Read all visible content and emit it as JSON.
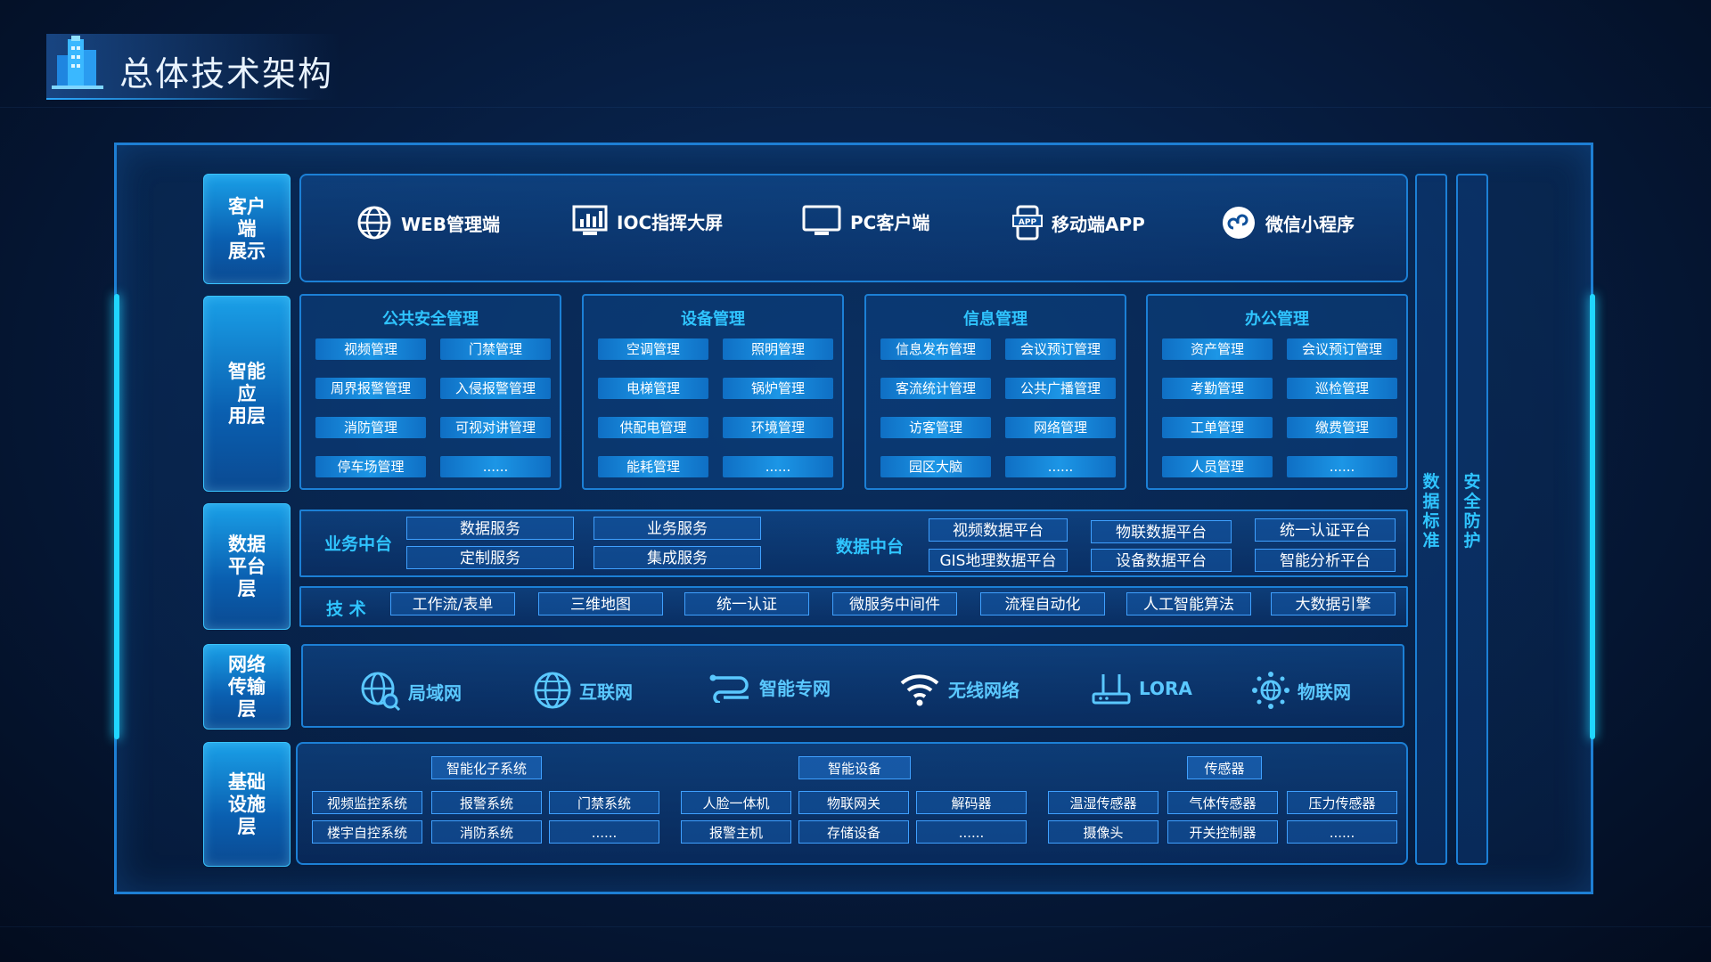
{
  "page_title": "总体技术架构",
  "layers": {
    "client": "客户端\n展示",
    "app": "智能应\n用层",
    "data": "数据\n平台层",
    "network": "网络\n传输层",
    "infra": "基础\n设施层"
  },
  "clients": [
    {
      "label": "WEB管理端",
      "icon": "globe-icon"
    },
    {
      "label": "IOC指挥大屏",
      "icon": "bar-chart-screen-icon"
    },
    {
      "label": "PC客户端",
      "icon": "monitor-icon"
    },
    {
      "label": "移动端APP",
      "icon": "mobile-app-icon"
    },
    {
      "label": "微信小程序",
      "icon": "mini-program-icon"
    }
  ],
  "app_groups": [
    {
      "title": "公共安全管理",
      "items": [
        "视频管理",
        "门禁管理",
        "周界报警管理",
        "入侵报警管理",
        "消防管理",
        "可视对讲管理",
        "停车场管理",
        "......"
      ]
    },
    {
      "title": "设备管理",
      "items": [
        "空调管理",
        "照明管理",
        "电梯管理",
        "锅炉管理",
        "供配电管理",
        "环境管理",
        "能耗管理",
        "......"
      ]
    },
    {
      "title": "信息管理",
      "items": [
        "信息发布管理",
        "会议预订管理",
        "客流统计管理",
        "公共广播管理",
        "访客管理",
        "网络管理",
        "园区大脑",
        "......"
      ]
    },
    {
      "title": "办公管理",
      "items": [
        "资产管理",
        "会议预订管理",
        "考勤管理",
        "巡检管理",
        "工单管理",
        "缴费管理",
        "人员管理",
        "......"
      ]
    }
  ],
  "data_platform": {
    "business_label": "业务中台",
    "business_items": [
      "数据服务",
      "业务服务",
      "定制服务",
      "集成服务"
    ],
    "data_label": "数据中台",
    "data_items": [
      "视频数据平台",
      "物联数据平台",
      "统一认证平台",
      "GIS地理数据平台",
      "设备数据平台",
      "智能分析平台"
    ],
    "tech_label": "技 术",
    "tech_items": [
      "工作流/表单",
      "三维地图",
      "统一认证",
      "微服务中间件",
      "流程自动化",
      "人工智能算法",
      "大数据引擎"
    ]
  },
  "network": [
    {
      "label": "局域网",
      "icon": "lan-globe-icon"
    },
    {
      "label": "互联网",
      "icon": "globe-icon"
    },
    {
      "label": "智能专网",
      "icon": "private-network-icon"
    },
    {
      "label": "无线网络",
      "icon": "wifi-icon"
    },
    {
      "label": "LORA",
      "icon": "lora-router-icon"
    },
    {
      "label": "物联网",
      "icon": "iot-icon"
    }
  ],
  "infra": {
    "groups": [
      {
        "title": "智能化子系统",
        "items": [
          "视频监控系统",
          "报警系统",
          "门禁系统",
          "楼宇自控系统",
          "消防系统",
          "......"
        ]
      },
      {
        "title": "智能设备",
        "items": [
          "人脸一体机",
          "物联网关",
          "解码器",
          "报警主机",
          "存储设备",
          "......"
        ]
      },
      {
        "title": "传感器",
        "items": [
          "温湿传感器",
          "气体传感器",
          "压力传感器",
          "摄像头",
          "开关控制器",
          "......"
        ]
      }
    ]
  },
  "side": {
    "data_standard": [
      "数",
      "据",
      "标",
      "准"
    ],
    "security": [
      "安",
      "全",
      "防",
      "护"
    ]
  },
  "colors": {
    "accent": "#2fc4ff",
    "border": "#1c80d6",
    "glow": "#20d6ff"
  }
}
